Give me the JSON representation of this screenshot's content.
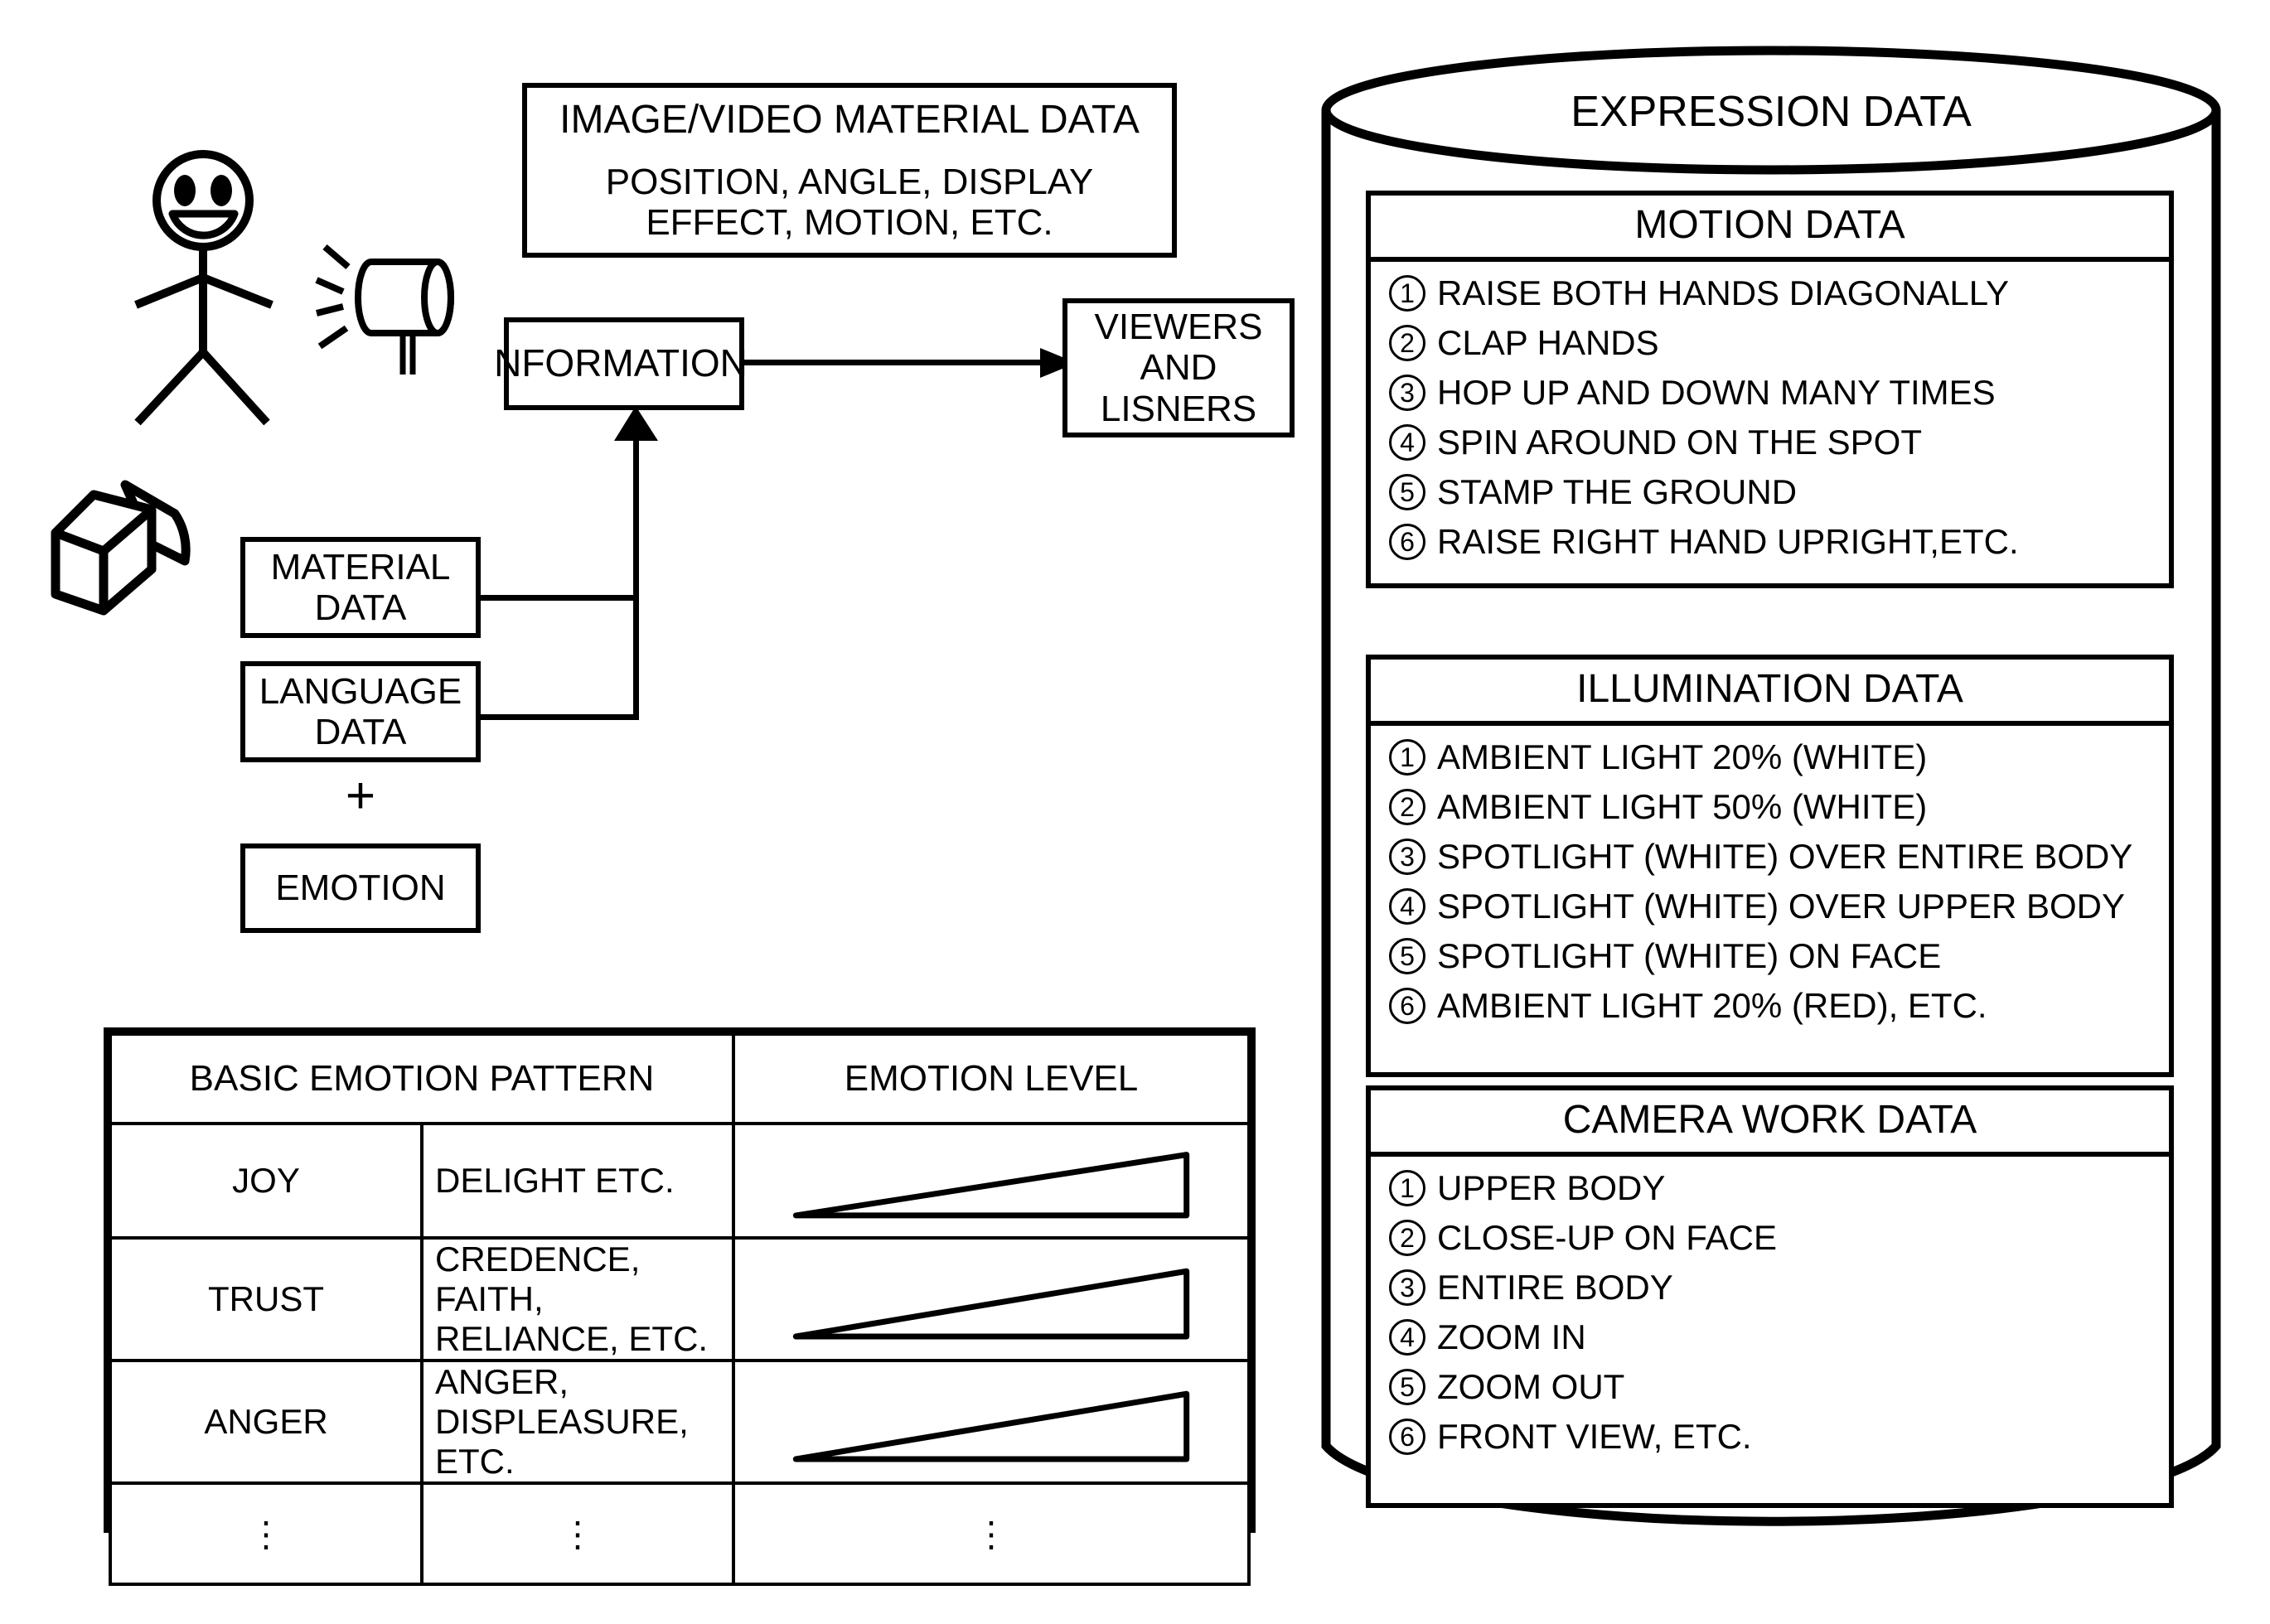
{
  "top_box": {
    "title": "IMAGE/VIDEO MATERIAL DATA",
    "subtitle_line1": "POSITION, ANGLE, DISPLAY",
    "subtitle_line2": "EFFECT, MOTION, ETC."
  },
  "information_box": {
    "label": "NFORMATION"
  },
  "viewers_box": {
    "line1": "VIEWERS",
    "line2": "AND",
    "line3": "LISNERS"
  },
  "left_boxes": {
    "material_line1": "MATERIAL",
    "material_line2": "DATA",
    "language_line1": "LANGUAGE",
    "language_line2": "DATA",
    "plus": "+",
    "emotion": "EMOTION"
  },
  "icons": {
    "person": "stick-figure-icon",
    "spotlight": "spotlight-icon",
    "camera": "camera-box-icon"
  },
  "emotion_table": {
    "headers": [
      "BASIC EMOTION PATTERN",
      "EMOTION LEVEL"
    ],
    "rows": [
      {
        "name": "JOY",
        "desc": "DELIGHT ETC.",
        "level": "ramp"
      },
      {
        "name": "TRUST",
        "desc": "CREDENCE, FAITH, RELIANCE, ETC.",
        "level": "ramp"
      },
      {
        "name": "ANGER",
        "desc": "ANGER, DISPLEASURE, ETC.",
        "level": "ramp"
      },
      {
        "name": "⋮",
        "desc": "⋮",
        "level": "⋮"
      }
    ]
  },
  "cylinder": {
    "title": "EXPRESSION DATA",
    "panels": [
      {
        "title": "MOTION DATA",
        "items": [
          "RAISE BOTH HANDS DIAGONALLY",
          "CLAP HANDS",
          "HOP UP AND DOWN MANY TIMES",
          "SPIN AROUND ON THE SPOT",
          "STAMP THE GROUND",
          "RAISE RIGHT HAND UPRIGHT,ETC."
        ]
      },
      {
        "title": "ILLUMINATION DATA",
        "items": [
          "AMBIENT LIGHT 20% (WHITE)",
          "AMBIENT LIGHT 50% (WHITE)",
          "SPOTLIGHT (WHITE) OVER ENTIRE BODY",
          "SPOTLIGHT (WHITE) OVER UPPER BODY",
          "SPOTLIGHT (WHITE) ON FACE",
          "AMBIENT LIGHT 20% (RED), ETC."
        ]
      },
      {
        "title": "CAMERA WORK DATA",
        "items": [
          "UPPER BODY",
          "CLOSE-UP ON FACE",
          "ENTIRE BODY",
          "ZOOM IN",
          "ZOOM OUT",
          "FRONT VIEW, ETC."
        ]
      }
    ],
    "numbers": [
      "1",
      "2",
      "3",
      "4",
      "5",
      "6"
    ]
  },
  "colors": {
    "ink": "#000000",
    "paper": "#ffffff"
  }
}
